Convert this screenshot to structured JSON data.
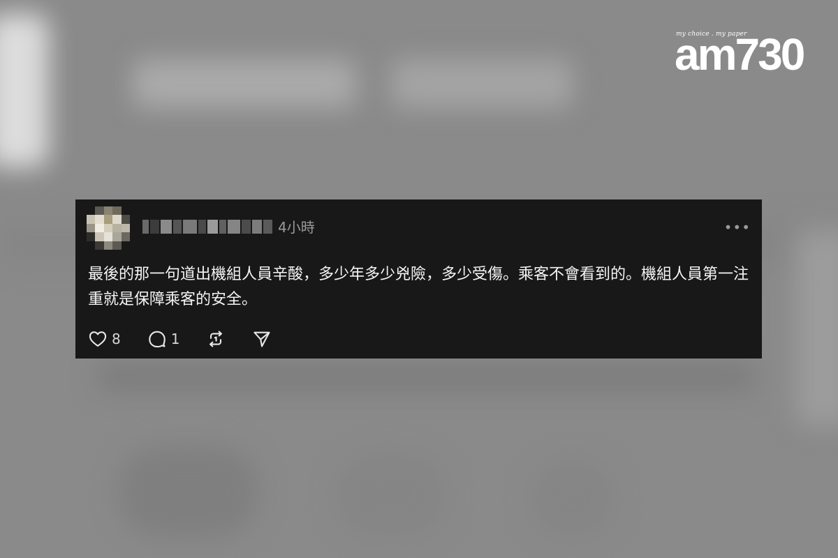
{
  "logo": {
    "tagline": "my choice . my paper",
    "brand": "am730"
  },
  "post": {
    "username_obscured": true,
    "timestamp": "4小時",
    "more_icon": "more-horizontal-icon",
    "text": "最後的那一句道出機組人員辛酸，多少年多少兇險，多少受傷。乘客不會看到的。機組人員第一注重就是保障乘客的安全。",
    "actions": {
      "like": {
        "icon": "heart-icon",
        "count": "8"
      },
      "reply": {
        "icon": "comment-icon",
        "count": "1"
      },
      "repost": {
        "icon": "repost-icon"
      },
      "share": {
        "icon": "send-icon"
      }
    }
  },
  "colors": {
    "card_background": "#181818",
    "page_background": "#8a8a8a",
    "text_primary": "#f5f5f5",
    "text_secondary": "#9a9a9a"
  }
}
